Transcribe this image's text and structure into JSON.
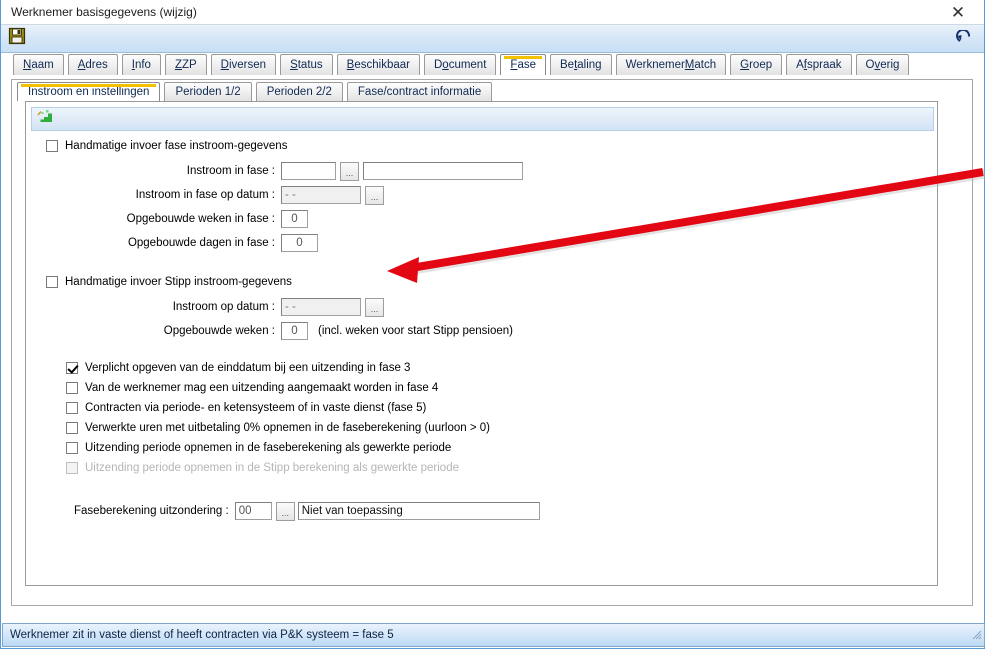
{
  "window": {
    "title": "Werknemer basisgegevens  (wijzig)",
    "close_label": "✕"
  },
  "toolbar": {
    "save_icon": "save-floppy-icon",
    "undo_icon": "undo-arrow-icon"
  },
  "tabs": [
    {
      "label": "Naam",
      "accel": "N",
      "active": false
    },
    {
      "label": "Adres",
      "accel": "A",
      "active": false
    },
    {
      "label": "Info",
      "accel": "I",
      "active": false
    },
    {
      "label": "ZZP",
      "accel": "Z",
      "active": false
    },
    {
      "label": "Diversen",
      "accel": "D",
      "active": false
    },
    {
      "label": "Status",
      "accel": "S",
      "active": false
    },
    {
      "label": "Beschikbaar",
      "accel": "B",
      "active": false
    },
    {
      "label": "Document",
      "accel": "o",
      "active": false
    },
    {
      "label": "Fase",
      "accel": "F",
      "active": true
    },
    {
      "label": "Betaling",
      "accel": "t",
      "active": false
    },
    {
      "label": "WerknemerMatch",
      "accel": "M",
      "active": false
    },
    {
      "label": "Groep",
      "accel": "G",
      "active": false
    },
    {
      "label": "Afspraak",
      "accel": "f",
      "active": false
    },
    {
      "label": "Overig",
      "accel": "v",
      "active": false
    }
  ],
  "subtabs": [
    {
      "label": "Instroom en instellingen",
      "active": true
    },
    {
      "label": "Perioden 1/2",
      "active": false
    },
    {
      "label": "Perioden 2/2",
      "active": false
    },
    {
      "label": "Fase/contract informatie",
      "active": false
    }
  ],
  "panel_header": {
    "icon": "green-chart-wand-icon"
  },
  "form": {
    "fase_section": {
      "manual_checkbox": {
        "label": "Handmatige invoer fase instroom-gegevens",
        "checked": false,
        "disabled": false
      },
      "fields": [
        {
          "name": "instroom-in-fase",
          "label": "Instroom in fase :",
          "value": "",
          "description": "",
          "has_lookup": true,
          "has_description": true,
          "readonly": false
        },
        {
          "name": "instroom-in-fase-op-datum",
          "label": "Instroom in fase op datum :",
          "value": "-  -",
          "has_lookup": true,
          "has_description": false,
          "readonly": true
        },
        {
          "name": "opgebouwde-weken-in-fase",
          "label": "Opgebouwde weken in fase :",
          "value": "0",
          "has_lookup": false,
          "has_description": false,
          "readonly": false
        },
        {
          "name": "opgebouwde-dagen-in-fase",
          "label": "Opgebouwde dagen in fase :",
          "value": "0",
          "has_lookup": false,
          "has_description": false,
          "readonly": false
        }
      ]
    },
    "stipp_section": {
      "manual_checkbox": {
        "label": "Handmatige invoer Stipp instroom-gegevens",
        "checked": false,
        "disabled": false
      },
      "fields": [
        {
          "name": "stipp-instroom-op-datum",
          "label": "Instroom op datum :",
          "value": "-  -",
          "has_lookup": true,
          "readonly": true,
          "hint": ""
        },
        {
          "name": "stipp-opgebouwde-weken",
          "label": "Opgebouwde weken :",
          "value": "0",
          "has_lookup": false,
          "readonly": false,
          "hint": "(incl. weken voor start Stipp pensioen)"
        }
      ]
    },
    "options": [
      {
        "label": "Verplicht opgeven van de einddatum bij een uitzending in fase 3",
        "checked": true,
        "disabled": false
      },
      {
        "label": "Van de werknemer mag een uitzending aangemaakt worden in fase 4",
        "checked": false,
        "disabled": false
      },
      {
        "label": "Contracten via periode- en ketensysteem of in vaste dienst (fase 5)",
        "checked": false,
        "disabled": false
      },
      {
        "label": "Verwerkte uren met uitbetaling 0% opnemen in de faseberekening (uurloon > 0)",
        "checked": false,
        "disabled": false
      },
      {
        "label": "Uitzending periode opnemen in de faseberekening als gewerkte periode",
        "checked": false,
        "disabled": false
      },
      {
        "label": "Uitzending periode opnemen in de Stipp berekening als gewerkte periode",
        "checked": false,
        "disabled": true
      }
    ],
    "faseberekening": {
      "label": "Faseberekening uitzondering :",
      "code": "00",
      "description": "Niet van toepassing"
    }
  },
  "annotation": {
    "arrow_color": "#e30613",
    "arrow_name": "red-pointer-arrow"
  },
  "statusbar": {
    "text": "Werknemer zit in vaste dienst of heeft contracten via P&K systeem = fase 5"
  }
}
